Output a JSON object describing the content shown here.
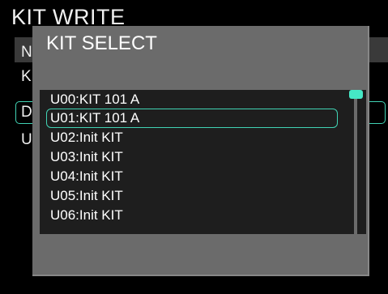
{
  "background": {
    "title": "KIT WRITE",
    "row_letters": [
      "N",
      "K",
      "D",
      "U"
    ]
  },
  "dialog": {
    "title": "KIT SELECT",
    "items": [
      "U00:KIT 101 A",
      "U01:KIT 101 A",
      "U02:Init KIT",
      "U03:Init KIT",
      "U04:Init KIT",
      "U05:Init KIT",
      "U06:Init KIT"
    ],
    "selected_index": 1,
    "scroll_position_fraction": 0.0
  },
  "colors": {
    "accent": "#41d3b4",
    "scroll_thumb": "#45e8c6",
    "dialog_bg": "#6b6b6b",
    "list_bg": "#1e1e1e"
  }
}
